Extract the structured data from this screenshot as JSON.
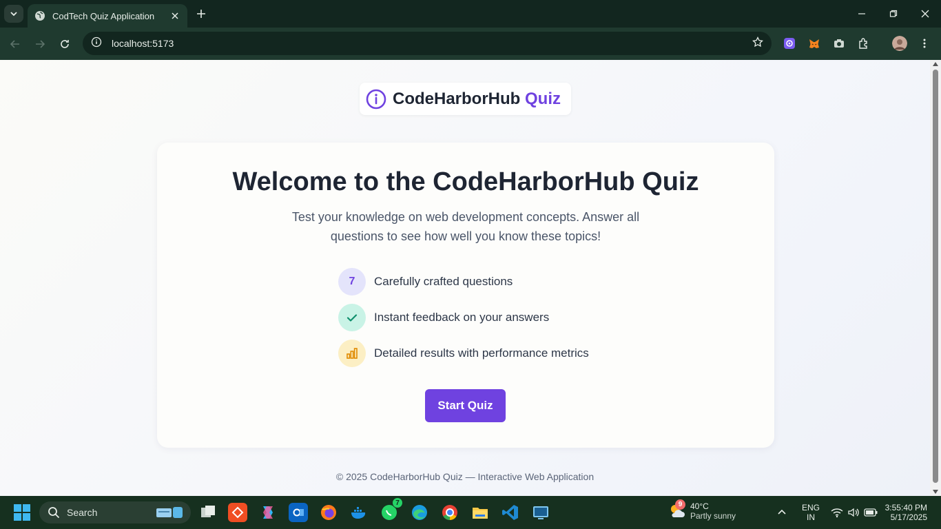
{
  "browser": {
    "tab_title": "CodTech Quiz Application",
    "url": "localhost:5173"
  },
  "page": {
    "logo_brand": "CodeHarborHub",
    "logo_accent": "Quiz",
    "heading": "Welcome to the CodeHarborHub Quiz",
    "subtitle": "Test your knowledge on web development concepts. Answer all questions to see how well you know these topics!",
    "features": [
      {
        "badge": "7",
        "text": "Carefully crafted questions",
        "icon": "number-badge"
      },
      {
        "badge": "",
        "text": "Instant feedback on your answers",
        "icon": "check-icon"
      },
      {
        "badge": "",
        "text": "Detailed results with performance metrics",
        "icon": "bar-chart-icon"
      }
    ],
    "start_button": "Start Quiz",
    "footer": "© 2025 CodeHarborHub Quiz — Interactive Web Application"
  },
  "colors": {
    "accent": "#6f42e0",
    "heading": "#1e2533",
    "feature1_bg": "#e4e4fb",
    "feature2_bg": "#c9f3e6",
    "feature3_bg": "#fcefc4"
  },
  "taskbar": {
    "search_label": "Search",
    "whatsapp_badge": "7",
    "weather_badge": "9",
    "temperature": "40°C",
    "weather_condition": "Partly sunny",
    "language_line1": "ENG",
    "language_line2": "IN",
    "time": "3:55:40 PM",
    "date": "5/17/2025"
  }
}
